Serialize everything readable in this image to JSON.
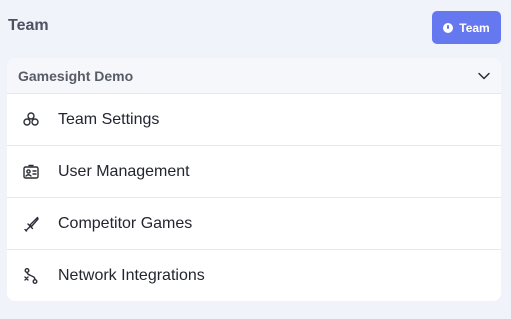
{
  "header": {
    "title": "Team",
    "team_button_label": "Team"
  },
  "team_card": {
    "selected_team": "Gamesight Demo",
    "items": [
      {
        "label": "Team Settings",
        "icon": "team-settings-icon"
      },
      {
        "label": "User Management",
        "icon": "id-card-icon"
      },
      {
        "label": "Competitor Games",
        "icon": "sword-icon"
      },
      {
        "label": "Network Integrations",
        "icon": "integrations-icon"
      }
    ]
  },
  "colors": {
    "background": "#f1f3fa",
    "accent": "#6678ef",
    "card": "#ffffff",
    "card_header": "#f6f7fb"
  }
}
